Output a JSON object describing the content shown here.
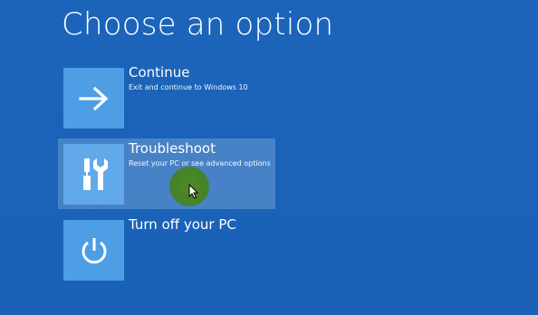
{
  "screen": {
    "title": "Choose an option",
    "background": "#1a63b8",
    "tile_color": "#4e9ee6"
  },
  "options": [
    {
      "title": "Continue",
      "description": "Exit and continue to Windows 10",
      "icon": "arrow-right-icon",
      "selected": false
    },
    {
      "title": "Troubleshoot",
      "description": "Reset your PC or see advanced options",
      "icon": "tools-icon",
      "selected": true
    },
    {
      "title": "Turn off your PC",
      "description": "",
      "icon": "power-icon",
      "selected": false
    }
  ],
  "pointer": {
    "icon": "mouse-cursor-icon",
    "click_highlight_color": "#4f8c1a"
  }
}
